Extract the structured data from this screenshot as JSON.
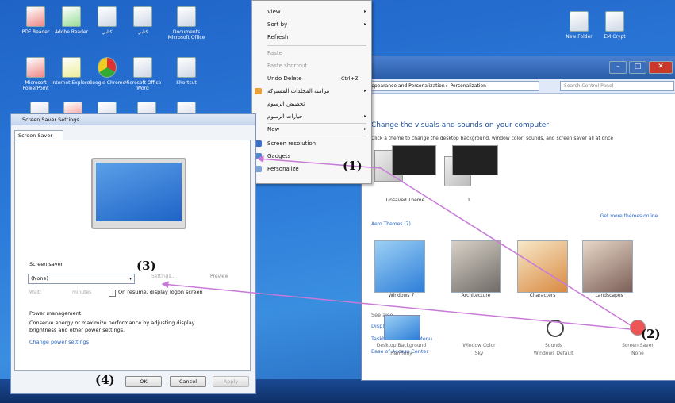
{
  "desktop": {
    "icons": [
      {
        "label": "PDF Reader",
        "glyph": "red"
      },
      {
        "label": "Adobe Reader",
        "glyph": "green"
      },
      {
        "label": "كتابي",
        "glyph": ""
      },
      {
        "label": "كتابي",
        "glyph": ""
      },
      {
        "label": "Documents Microsoft Office",
        "glyph": ""
      },
      {
        "label": "Microsoft PowerPoint",
        "glyph": "red"
      },
      {
        "label": "Internet Explorer",
        "glyph": "yellow"
      },
      {
        "label": "Google Chrome",
        "glyph": "chrome"
      },
      {
        "label": "Microsoft Office Word",
        "glyph": ""
      },
      {
        "label": "Shortcut",
        "glyph": ""
      },
      {
        "label": "",
        "glyph": ""
      },
      {
        "label": "",
        "glyph": "red"
      },
      {
        "label": "",
        "glyph": ""
      },
      {
        "label": "",
        "glyph": ""
      },
      {
        "label": "",
        "glyph": ""
      },
      {
        "label": "New Folder",
        "glyph": ""
      },
      {
        "label": "EM Crypt",
        "glyph": ""
      }
    ]
  },
  "context_menu": {
    "items": [
      {
        "label": "View",
        "submenu": true
      },
      {
        "label": "Sort by",
        "submenu": true
      },
      {
        "label": "Refresh"
      },
      {
        "label": "Paste",
        "disabled": true
      },
      {
        "label": "Paste shortcut",
        "disabled": true
      },
      {
        "label": "Undo Delete",
        "hotkey": "Ctrl+Z"
      },
      {
        "label": "مزامنة المجلدات المشتركة",
        "submenu": true
      },
      {
        "label": "تخصيص الرسوم"
      },
      {
        "label": "خيارات الرسوم",
        "submenu": true
      },
      {
        "label": "New",
        "submenu": true
      },
      {
        "label": "Screen resolution"
      },
      {
        "label": "Gadgets"
      },
      {
        "label": "Personalize"
      }
    ]
  },
  "personalization": {
    "address": "Appearance and Personalization  ▸  Personalization",
    "search_placeholder": "Search Control Panel",
    "heading": "Change the visuals and sounds on your computer",
    "subheading": "Click a theme to change the desktop background, window color, sounds, and screen saver all at once",
    "my_themes": [
      {
        "label": "Unsaved Theme"
      },
      {
        "label": "1"
      }
    ],
    "get_more_link": "Get more themes online",
    "aero_heading": "Aero Themes (7)",
    "aero_themes": [
      "Windows 7",
      "Architecture",
      "Characters",
      "Landscapes"
    ],
    "see_also_title": "See also",
    "see_also": [
      "Display",
      "Taskbar and Start Menu",
      "Ease of Access Center"
    ],
    "bottom_items": [
      {
        "label": "Desktop Background",
        "sub": "Harmony"
      },
      {
        "label": "Window Color",
        "sub": "Sky"
      },
      {
        "label": "Sounds",
        "sub": "Windows Default"
      },
      {
        "label": "Screen Saver",
        "sub": "None"
      }
    ]
  },
  "screen_saver": {
    "title": "Screen Saver Settings",
    "tab": "Screen Saver",
    "group_label": "Screen saver",
    "selected": "(None)",
    "settings_label": "Settings...",
    "preview_label": "Preview",
    "wait_label": "Wait:",
    "minutes_label": "minutes",
    "resume_label": "On resume, display logon screen",
    "power_title": "Power management",
    "power_text": "Conserve energy or maximize performance by adjusting display brightness and other power settings.",
    "power_link": "Change power settings",
    "ok": "OK",
    "cancel": "Cancel",
    "apply": "Apply"
  },
  "annotations": [
    "(1)",
    "(2)",
    "(3)",
    "(4)"
  ],
  "colors": {
    "accent": "#2a66c4",
    "arrow": "#c77ad8",
    "desktop": "#2c7bd9"
  }
}
